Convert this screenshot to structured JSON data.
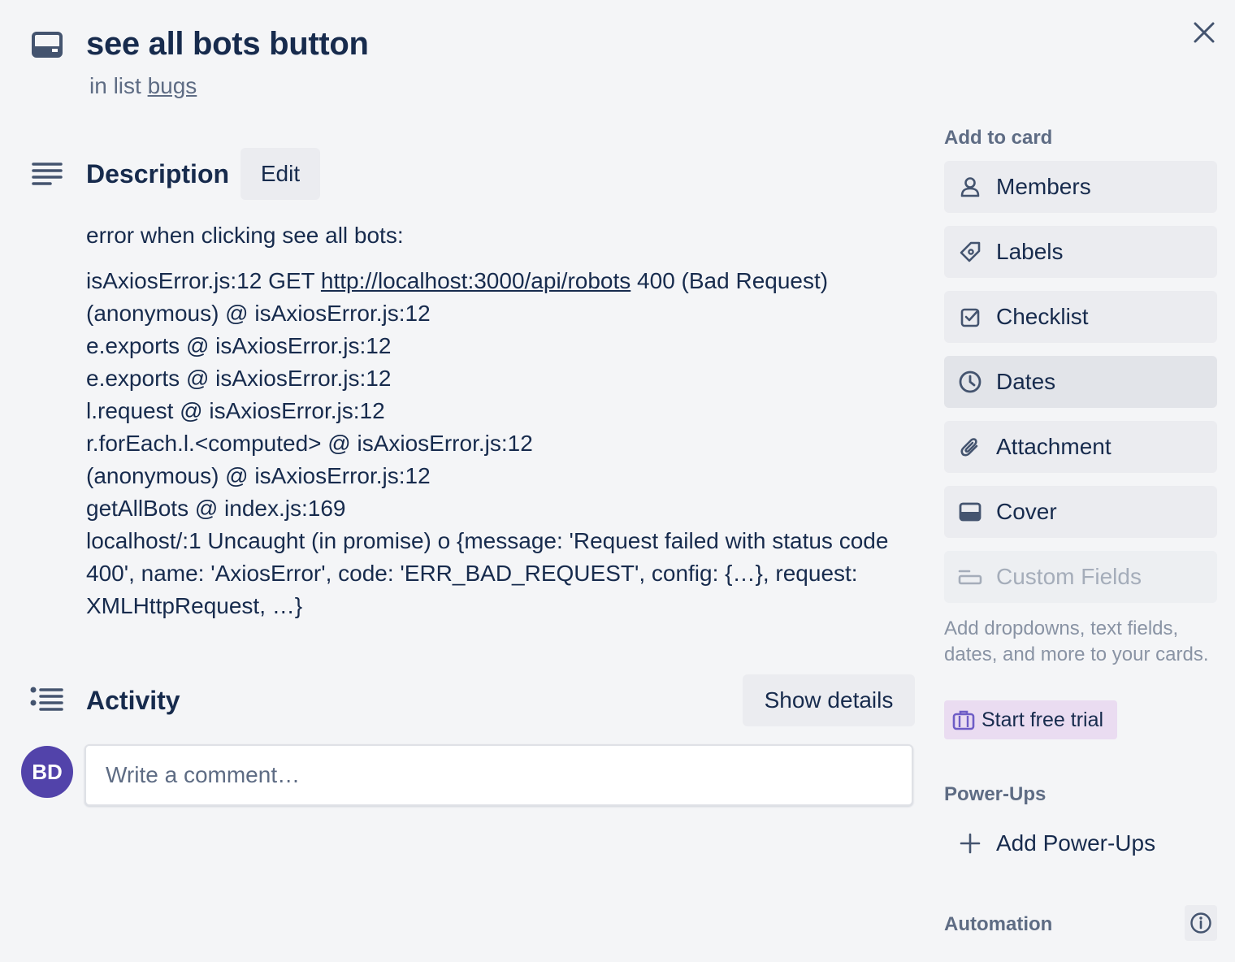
{
  "card": {
    "title": "see all bots button",
    "list_prefix": "in list",
    "list_name": "bugs"
  },
  "description": {
    "heading": "Description",
    "edit_label": "Edit",
    "intro": "error when clicking see all bots:",
    "line1_prefix": "isAxiosError.js:12 GET ",
    "line1_link": "http://localhost:3000/api/robots",
    "line1_suffix": " 400 (Bad Request)",
    "lines": [
      "(anonymous) @ isAxiosError.js:12",
      "e.exports @ isAxiosError.js:12",
      "e.exports @ isAxiosError.js:12",
      "l.request @ isAxiosError.js:12",
      "r.forEach.l.<computed> @ isAxiosError.js:12",
      "(anonymous) @ isAxiosError.js:12",
      "getAllBots @ index.js:169"
    ],
    "error_block": "localhost/:1 Uncaught (in promise) o {message: 'Request failed with status code 400', name: 'AxiosError', code: 'ERR_BAD_REQUEST', config: {…}, request: XMLHttpRequest, …}"
  },
  "activity": {
    "heading": "Activity",
    "show_details_label": "Show details",
    "avatar_initials": "BD",
    "comment_placeholder": "Write a comment…"
  },
  "sidebar": {
    "add_to_card_heading": "Add to card",
    "items": [
      {
        "label": "Members",
        "icon": "person-icon"
      },
      {
        "label": "Labels",
        "icon": "tag-icon"
      },
      {
        "label": "Checklist",
        "icon": "checkbox-icon"
      },
      {
        "label": "Dates",
        "icon": "clock-icon"
      },
      {
        "label": "Attachment",
        "icon": "paperclip-icon"
      },
      {
        "label": "Cover",
        "icon": "cover-icon"
      },
      {
        "label": "Custom Fields",
        "icon": "custom-fields-icon"
      }
    ],
    "custom_fields_note": "Add dropdowns, text fields, dates, and more to your cards.",
    "trial_label": "Start free trial",
    "power_ups_heading": "Power-Ups",
    "add_power_ups_label": "Add Power-Ups",
    "automation_heading": "Automation"
  },
  "colors": {
    "background": "#f4f5f7",
    "text": "#172b4d",
    "muted": "#5e6c84",
    "button": "#ebecf0",
    "avatar": "#5243aa",
    "trial": "#eadcf1"
  }
}
